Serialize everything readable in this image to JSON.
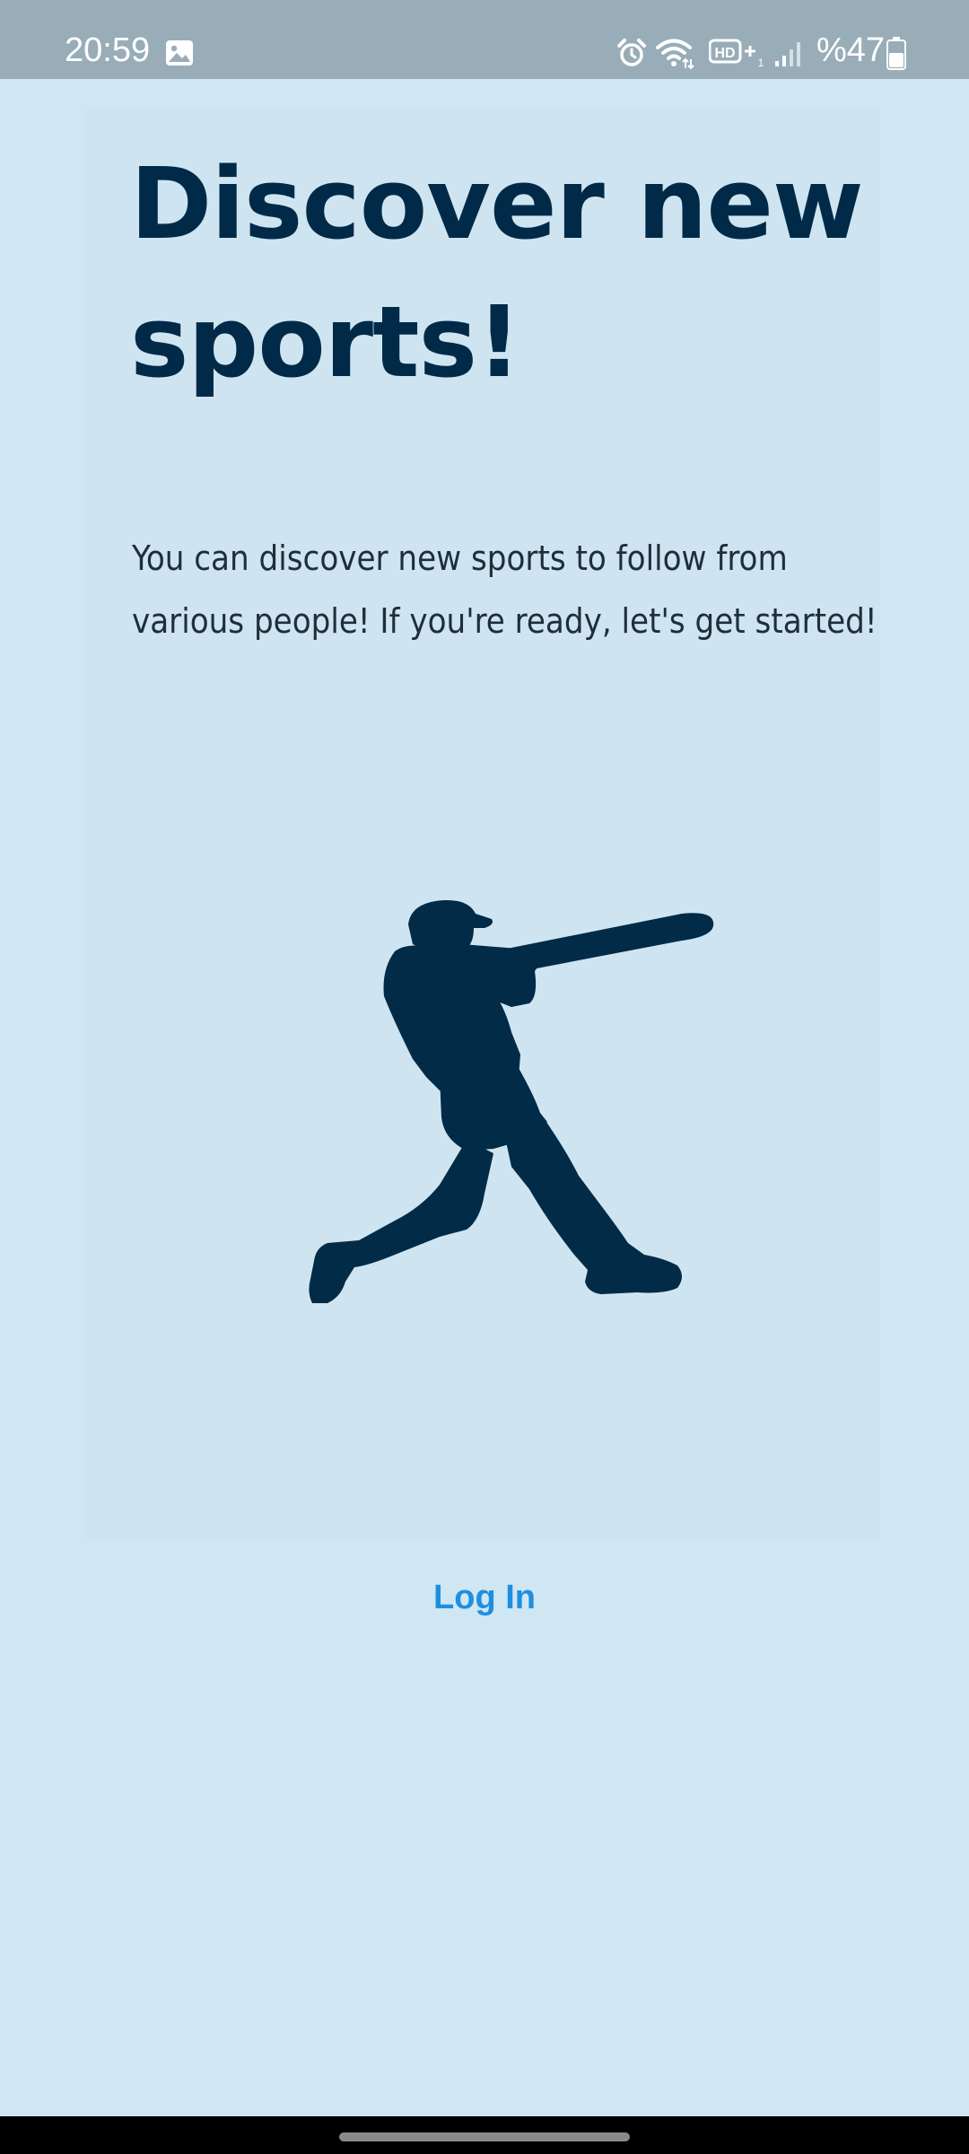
{
  "status_bar": {
    "time": "20:59",
    "battery_percent": "%47",
    "icons": [
      "gallery-icon",
      "alarm-icon",
      "wifi-icon",
      "hd-volte-icon",
      "signal-icon",
      "battery-icon"
    ]
  },
  "welcome": {
    "headline": "Discover new sports!",
    "description": "You can discover new sports to follow from various people! If you're ready, let's get started!",
    "illustration": "baseball-batter-icon"
  },
  "actions": {
    "login_label": "Log In"
  },
  "colors": {
    "background": "#cfe6f3",
    "headline": "#012a48",
    "illustration": "#022b48",
    "link": "#1e8fe0",
    "status_bar": "#98adb8"
  }
}
